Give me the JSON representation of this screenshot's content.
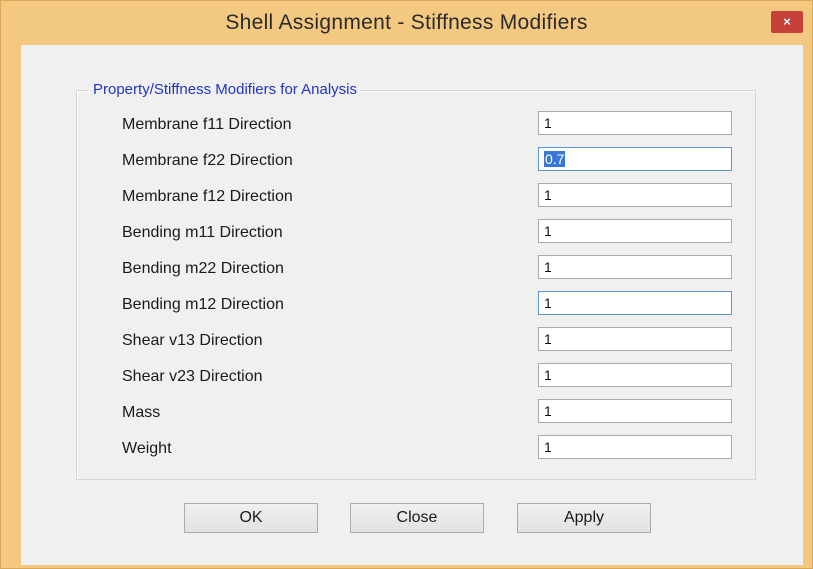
{
  "window": {
    "title": "Shell Assignment - Stiffness Modifiers",
    "close_glyph": "×"
  },
  "group": {
    "legend": "Property/Stiffness Modifiers for Analysis",
    "rows": [
      {
        "label": "Membrane f11 Direction",
        "value": "1"
      },
      {
        "label": "Membrane f22 Direction",
        "value": "0.7"
      },
      {
        "label": "Membrane f12 Direction",
        "value": "1"
      },
      {
        "label": "Bending m11 Direction",
        "value": "1"
      },
      {
        "label": "Bending m22 Direction",
        "value": "1"
      },
      {
        "label": "Bending m12 Direction",
        "value": "1"
      },
      {
        "label": "Shear v13 Direction",
        "value": "1"
      },
      {
        "label": "Shear v23 Direction",
        "value": "1"
      },
      {
        "label": "Mass",
        "value": "1"
      },
      {
        "label": "Weight",
        "value": "1"
      }
    ]
  },
  "buttons": {
    "ok": "OK",
    "close": "Close",
    "apply": "Apply"
  },
  "colors": {
    "titlebar": "#f3c981",
    "close_button": "#c7403a",
    "legend_text": "#1f35c8",
    "selection": "#3a78d8"
  },
  "icons": {
    "close": "close-icon"
  }
}
